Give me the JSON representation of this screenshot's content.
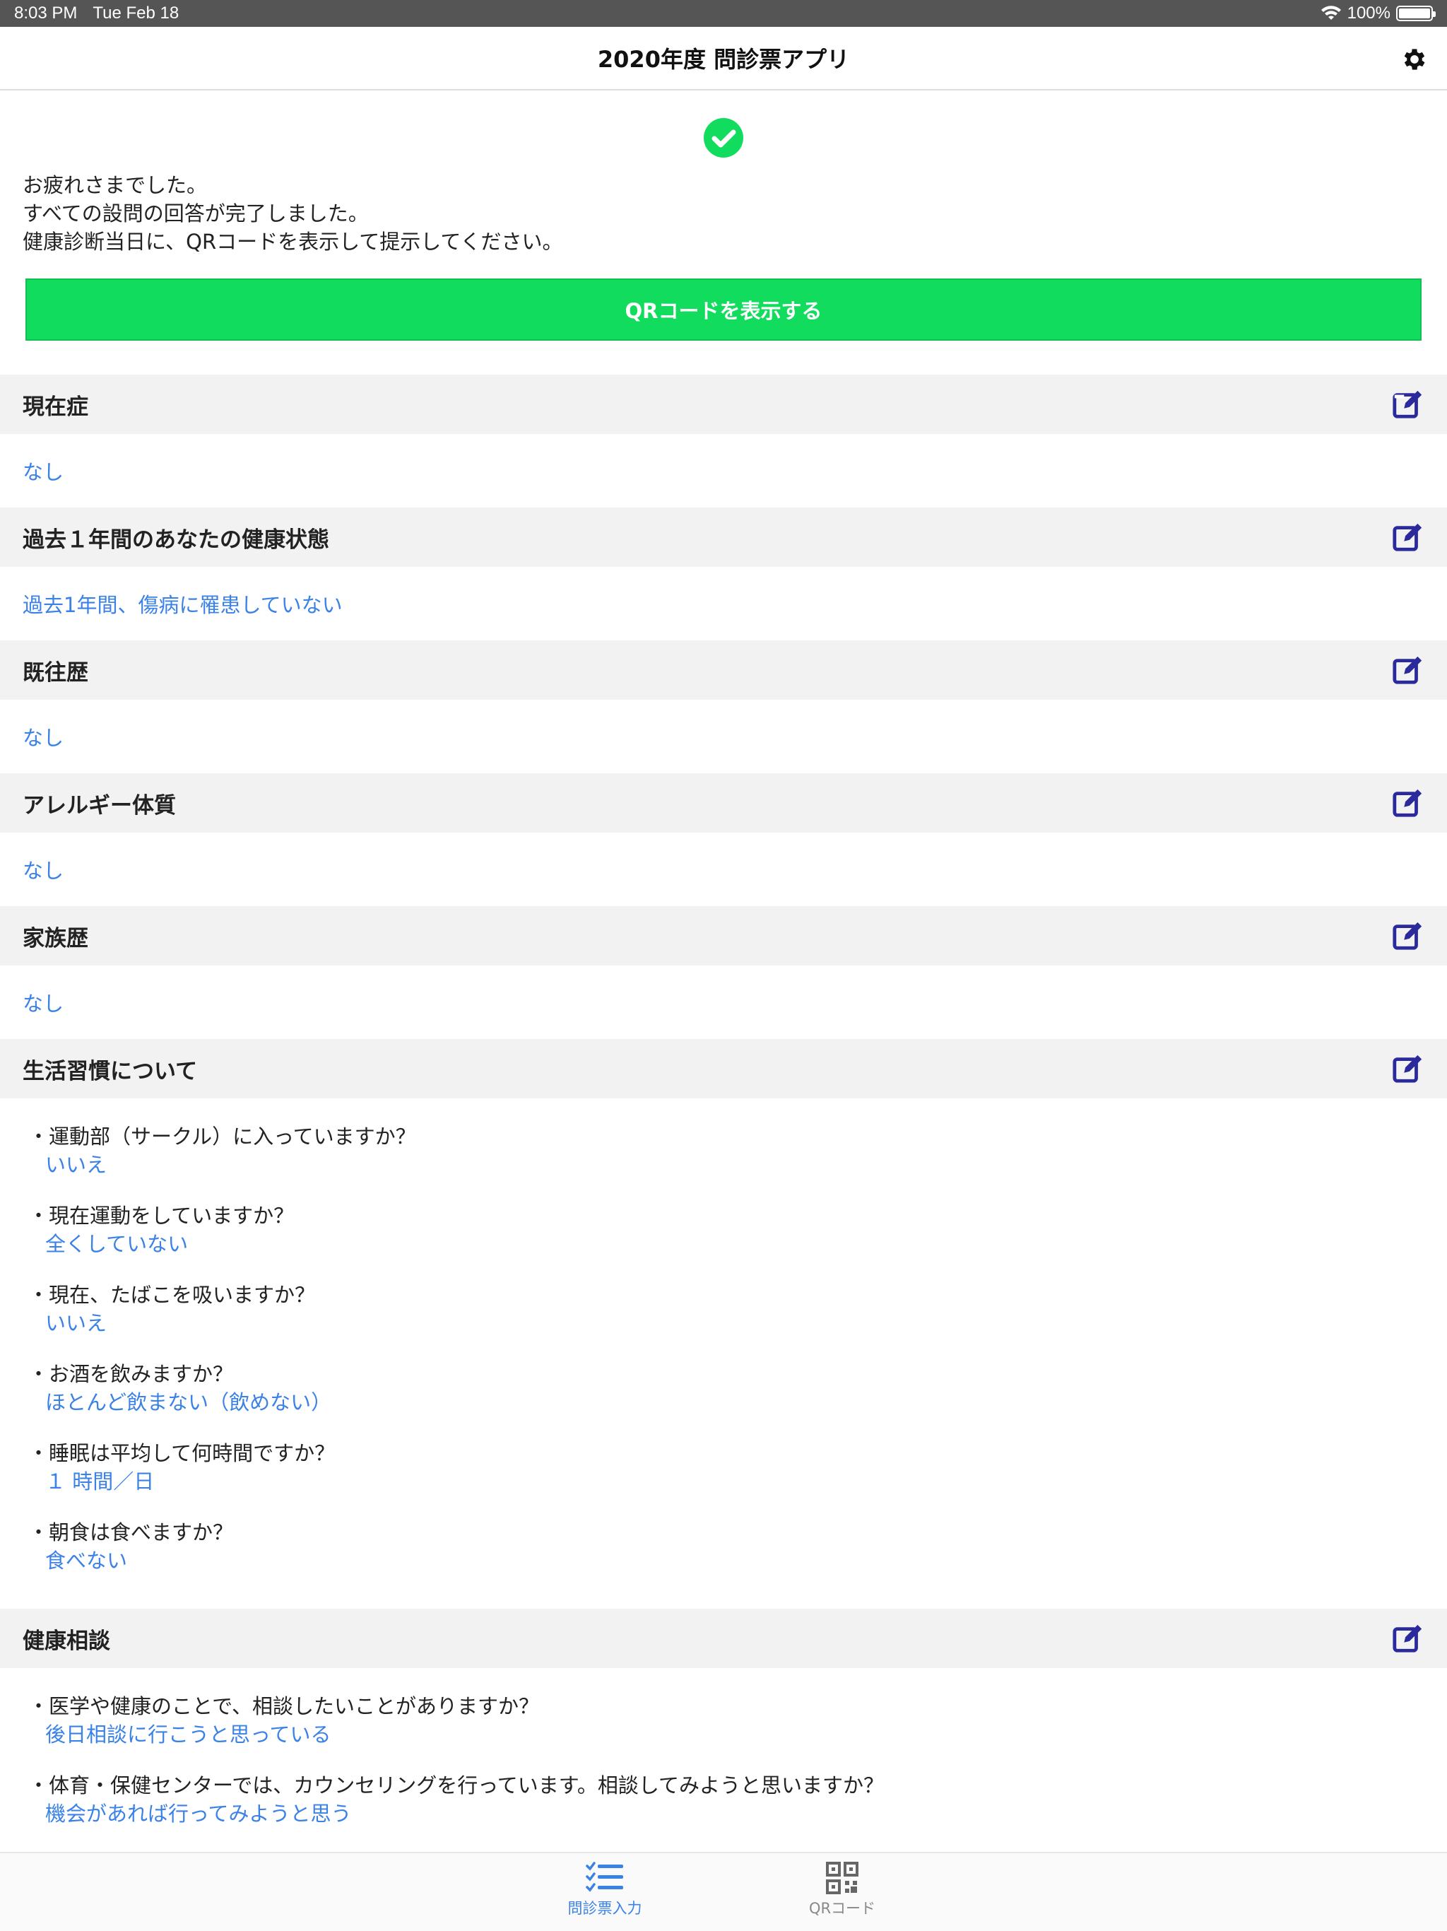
{
  "status_bar": {
    "time": "8:03 PM",
    "date": "Tue Feb 18",
    "battery": "100%"
  },
  "header": {
    "title": "2020年度 問診票アプリ"
  },
  "completion": {
    "lines": [
      "お疲れさまでした。",
      "すべての設問の回答が完了しました。",
      "健康診断当日に、QRコードを表示して提示してください。"
    ],
    "qr_button_label": "QRコードを表示する"
  },
  "sections": {
    "current": {
      "title": "現在症",
      "answer": "なし"
    },
    "past_year": {
      "title": "過去１年間のあなたの健康状態",
      "answer": "過去1年間、傷病に罹患していない"
    },
    "history": {
      "title": "既往歴",
      "answer": "なし"
    },
    "allergy": {
      "title": "アレルギー体質",
      "answer": "なし"
    },
    "family": {
      "title": "家族歴",
      "answer": "なし"
    },
    "lifestyle": {
      "title": "生活習慣について",
      "items": [
        {
          "q": "・運動部（サークル）に入っていますか？",
          "a": "いいえ"
        },
        {
          "q": "・現在運動をしていますか？",
          "a": "全くしていない"
        },
        {
          "q": "・現在、たばこを吸いますか？",
          "a": "いいえ"
        },
        {
          "q": "・お酒を飲みますか？",
          "a": "ほとんど飲まない（飲めない）"
        },
        {
          "q": "・睡眠は平均して何時間ですか？",
          "a": "１ 時間／日"
        },
        {
          "q": "・朝食は食べますか？",
          "a": "食べない"
        }
      ]
    },
    "consult": {
      "title": "健康相談",
      "items": [
        {
          "q": "・医学や健康のことで、相談したいことがありますか？",
          "a": "後日相談に行こうと思っている"
        },
        {
          "q": "・体育・保健センターでは、カウンセリングを行っています。相談してみようと思いますか？",
          "a": "機会があれば行ってみようと思う"
        }
      ]
    }
  },
  "tabbar": {
    "tabs": [
      {
        "label": "問診票入力",
        "icon": "checklist-icon",
        "active": true
      },
      {
        "label": "QRコード",
        "icon": "qr-code-icon",
        "active": false
      }
    ]
  },
  "colors": {
    "accent": "#3b82e6",
    "button_green": "#12dc5e",
    "edit_icon": "#2a2a9c",
    "section_bg": "#f2f2f2"
  }
}
